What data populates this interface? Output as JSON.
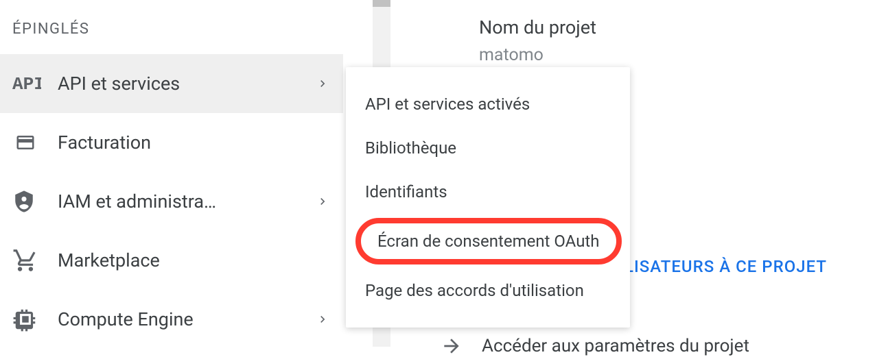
{
  "sidebar": {
    "pinned_label": "ÉPINGLÉS",
    "items": [
      {
        "label": "API et services",
        "icon": "api",
        "has_submenu": true,
        "active": true
      },
      {
        "label": "Facturation",
        "icon": "billing",
        "has_submenu": false
      },
      {
        "label": "IAM et administra…",
        "icon": "iam",
        "has_submenu": true
      },
      {
        "label": "Marketplace",
        "icon": "marketplace",
        "has_submenu": false
      },
      {
        "label": "Compute Engine",
        "icon": "compute",
        "has_submenu": true
      }
    ]
  },
  "submenu": {
    "items": [
      {
        "label": "API et services activés"
      },
      {
        "label": "Bibliothèque"
      },
      {
        "label": "Identifiants"
      },
      {
        "label": "Écran de consentement OAuth",
        "highlighted": true
      },
      {
        "label": "Page des accords d'utilisation"
      }
    ]
  },
  "content": {
    "project_label": "Nom du projet",
    "project_name": "matomo",
    "users_link": "LISATEURS À CE PROJET",
    "settings_link": "Accéder aux paramètres du projet"
  }
}
